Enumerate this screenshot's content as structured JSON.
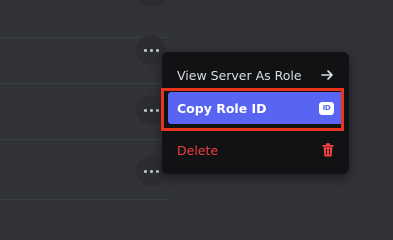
{
  "context_menu": {
    "view_as_role_label": "View Server As Role",
    "copy_role_id_label": "Copy Role ID",
    "id_badge_text": "ID",
    "delete_label": "Delete"
  },
  "colors": {
    "background": "#313338",
    "menu_bg": "#111214",
    "selected_item": "#5865f2",
    "danger": "#f23f43",
    "highlight_box": "#e8331d"
  },
  "icons": {
    "more": "more-icon",
    "arrow": "arrow-right-icon",
    "id": "id-badge-icon",
    "trash": "trash-icon"
  }
}
